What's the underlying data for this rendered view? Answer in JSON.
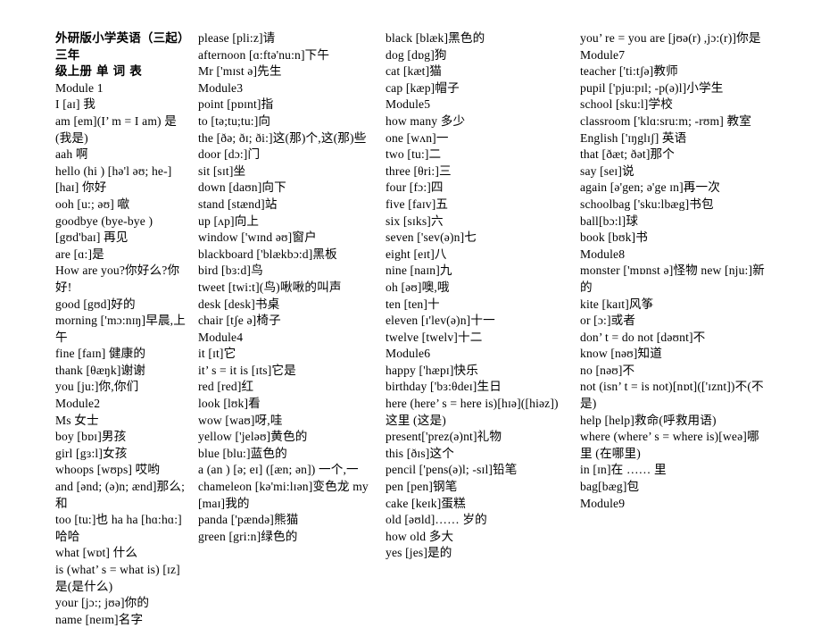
{
  "document": {
    "title_line_1": "外研版小学英语（三起）三年",
    "title_line_2": "级上册 单 词 表",
    "title_full": "外研版小学英语（三起）三年级上册 单 词 表"
  },
  "columns": [
    {
      "id": "column-1",
      "entries": [
        "Module 1",
        "I [aɪ] 我",
        "am [em](I’ m = I am) 是(我是)",
        "aah 啊",
        "hello (hi ) [hə'l əʊ; he-][haɪ] 你好",
        "ooh [u:; əʊ] 噷",
        "goodbye (bye-bye ) [gʊd'baɪ] 再见",
        "are [ɑ:]是",
        "How are you?你好么?你好!",
        "good [gʊd]好的",
        "morning ['mɔ:nɪŋ]早晨,上午",
        "fine [faɪn] 健康的",
        "thank [θæŋk]谢谢",
        "you [ju:]你,你们",
        "Module2",
        "Ms 女士",
        "boy [bɒɪ]男孩",
        "girl [gɜ:l]女孩",
        "whoops [wʊps] 哎哟",
        "and [ənd; (ə)n; ænd]那么;和",
        "too [tu:]也 ha ha [hɑ:hɑ:]哈哈",
        "what [wɒt] 什么",
        "is (what’ s = what is) [ɪz] 是(是什么)",
        "your [jɔ:; jʊə]你的",
        "name [neɪm]名字"
      ]
    },
    {
      "id": "column-2",
      "entries": [
        "please [pli:z]请",
        "afternoon [ɑ:ftə'nu:n]下午",
        "Mr ['mɪst ə]先生",
        "Module3",
        "point [pɒɪnt]指",
        "to [tə;tu;tu:]向",
        "the [ðə; ðɪ; ði:]这(那)个,这(那)些",
        "door [dɔ:]门",
        "sit [sɪt]坐",
        "down [daʊn]向下",
        "stand [stænd]站",
        "up [ʌp]向上",
        "window ['wɪnd əʊ]窗户",
        "blackboard ['blækbɔ:d]黑板",
        "bird [bɜ:d]鸟",
        "tweet [twi:t](鸟)啾啾的叫声",
        "desk [desk]书桌",
        "chair [tʃe ə]椅子",
        "Module4",
        "it [ɪt]它",
        "it’ s = it is [ɪts]它是",
        "red [red]红",
        "look [lʊk]看",
        "wow [waʊ]呀,哇",
        "yellow ['jeləʊ]黄色的",
        "blue [blu:]蓝色的",
        "a (an ) [ə; eɪ] ([æn; ən]) 一个,一 chameleon [kə'mi:lɪən]变色龙 my [maɪ]我的",
        "panda ['pændə]熊猫",
        "green [gri:n]绿色的"
      ]
    },
    {
      "id": "column-3",
      "entries": [
        "black [blæk]黑色的",
        "dog [dɒg]狗",
        "cat [kæt]猫",
        "cap [kæp]帽子",
        "Module5",
        "how many 多少",
        "one [wʌn]一",
        "two [tu:]二",
        "three [θri:]三",
        "four [fɔ:]四",
        "five [faɪv]五",
        "six [sɪks]六",
        "seven ['sev(ə)n]七",
        "eight [eɪt]八",
        "nine [naɪn]九",
        "oh [əʊ]噢,哦",
        "ten [ten]十",
        "eleven [ɪ'lev(ə)n]十一",
        "twelve [twelv]十二",
        "Module6",
        "happy ['hæpɪ]快乐",
        "birthday ['bɜ:θdeɪ]生日",
        "here (here’ s = here is)[hɪə]([hiəz]) 这里 (这是)",
        "present['prez(ə)nt]礼物",
        "this [ðɪs]这个",
        "pencil ['pens(ə)l; -sɪl]铅笔",
        "pen [pen]钢笔",
        "cake [keɪk]蛋糕",
        "old [əʊld]…… 岁的",
        "how old 多大",
        "yes [jes]是的"
      ]
    },
    {
      "id": "column-4",
      "entries": [
        "you’ re = you are [jʊə(r) ,jɔ:(r)]你是",
        "Module7",
        "teacher ['ti:tʃə]教师",
        "pupil ['pju:pɪl; -p(ə)l]小学生",
        "school [sku:l]学校",
        "classroom ['klɑ:sru:m; -rʊm] 教室",
        "English ['ɪŋglɪʃ] 英语",
        "that [ðæt; ðət]那个",
        "say [seɪ]说",
        "again [ə'gen; ə'ge ɪn]再一次",
        "schoolbag ['sku:lbæg]书包",
        "ball[bɔ:l]球",
        "book [bʊk]书",
        "Module8",
        "monster ['mɒnst ə]怪物 new [nju:]新的",
        "kite [kaɪt]风筝",
        "or [ɔ:]或者",
        "don’ t = do not [dəʊnt]不",
        "know [nəʊ]知道",
        "no [nəʊ]不",
        "not (isn’ t = is not)[nɒt](['ɪznt])不(不是)",
        "help [help]救命(呼救用语)",
        "where (where’ s = where is)[weə]哪里 (在哪里)",
        "in [ɪn]在 …… 里",
        "bag[bæg]包",
        "Module9"
      ]
    }
  ]
}
